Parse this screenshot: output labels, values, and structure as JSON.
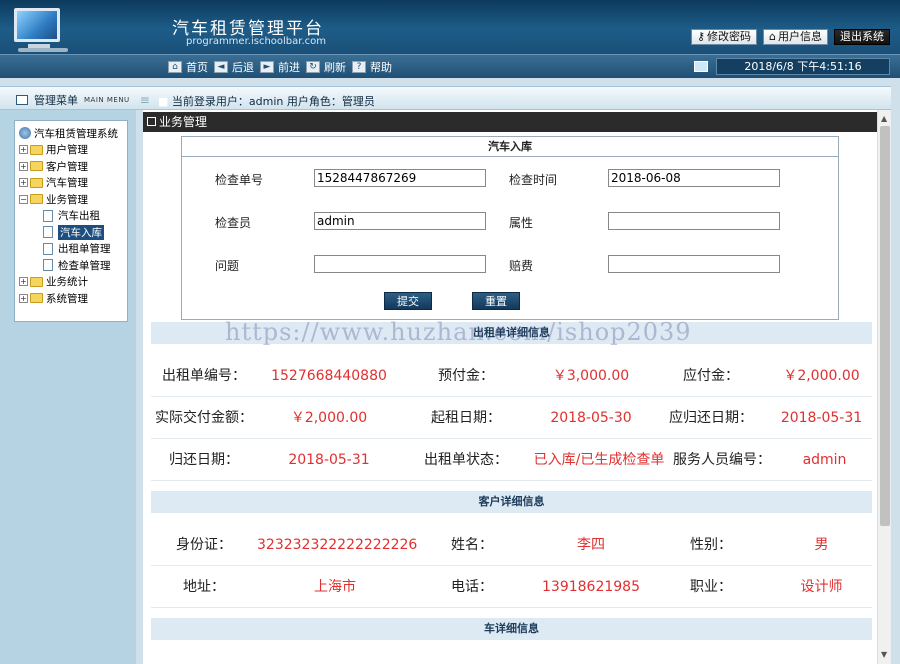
{
  "header": {
    "title": "汽车租赁管理平台",
    "subtitle": "programmer.ischoolbar.com",
    "buttons": {
      "change_password": "修改密码",
      "user_info": "用户信息",
      "logout": "退出系统"
    }
  },
  "toolbar": {
    "nav": [
      "首页",
      "后退",
      "前进",
      "刷新",
      "帮助"
    ],
    "datetime": "2018/6/8 下午4:51:16"
  },
  "subbar": {
    "menu_title": "管理菜单",
    "menu_mini": "MAIN MENU",
    "user_info": "当前登录用户：admin  用户角色：管理员"
  },
  "sidebar": {
    "root": "汽车租赁管理系统",
    "items": [
      {
        "label": "用户管理",
        "type": "folder",
        "state": "+"
      },
      {
        "label": "客户管理",
        "type": "folder",
        "state": "+"
      },
      {
        "label": "汽车管理",
        "type": "folder",
        "state": "+"
      },
      {
        "label": "业务管理",
        "type": "folder",
        "state": "-"
      },
      {
        "label": "汽车出租",
        "type": "doc"
      },
      {
        "label": "汽车入库",
        "type": "doc",
        "selected": true
      },
      {
        "label": "出租单管理",
        "type": "doc"
      },
      {
        "label": "检查单管理",
        "type": "doc"
      },
      {
        "label": "业务统计",
        "type": "folder",
        "state": "+"
      },
      {
        "label": "系统管理",
        "type": "folder",
        "state": "+"
      }
    ]
  },
  "main": {
    "title": "业务管理",
    "form": {
      "title": "汽车入库",
      "fields": {
        "check_no": {
          "label": "检查单号",
          "value": "1528447867269"
        },
        "check_time": {
          "label": "检查时间",
          "value": "2018-06-08"
        },
        "inspector": {
          "label": "检查员",
          "value": "admin"
        },
        "attribute": {
          "label": "属性",
          "value": ""
        },
        "problem": {
          "label": "问题",
          "value": ""
        },
        "compensation": {
          "label": "赔费",
          "value": ""
        }
      },
      "submit": "提交",
      "reset": "重置"
    },
    "watermark": "https://www.huzhan.com/ishop2039",
    "rental_section": {
      "title": "出租单详细信息",
      "rows": [
        [
          {
            "label": "出租单编号：",
            "value": "1527668440880"
          },
          {
            "label": "预付金：",
            "value": "￥3,000.00"
          },
          {
            "label": "应付金：",
            "value": "￥2,000.00"
          }
        ],
        [
          {
            "label": "实际交付金额：",
            "value": "￥2,000.00"
          },
          {
            "label": "起租日期：",
            "value": "2018-05-30"
          },
          {
            "label": "应归还日期：",
            "value": "2018-05-31"
          }
        ],
        [
          {
            "label": "归还日期：",
            "value": "2018-05-31"
          },
          {
            "label": "出租单状态：",
            "value": "已入库/已生成检查单"
          },
          {
            "label": "服务人员编号：",
            "value": "admin"
          }
        ]
      ]
    },
    "customer_section": {
      "title": "客户详细信息",
      "rows": [
        [
          {
            "label": "身份证：",
            "value": "323232322222222226"
          },
          {
            "label": "姓名：",
            "value": "李四"
          },
          {
            "label": "性别：",
            "value": "男"
          }
        ],
        [
          {
            "label": "地址：",
            "value": "上海市"
          },
          {
            "label": "电话：",
            "value": "13918621985"
          },
          {
            "label": "职业：",
            "value": "设计师"
          }
        ]
      ]
    },
    "car_section": {
      "title": "车详细信息"
    }
  }
}
